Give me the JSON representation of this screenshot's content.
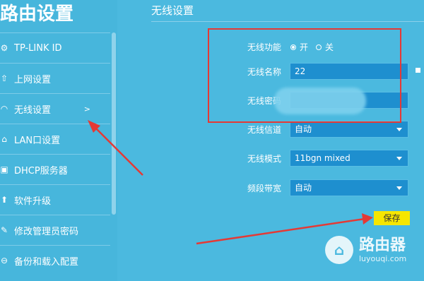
{
  "app": {
    "title": "路由设置"
  },
  "sidebar": {
    "items": [
      {
        "label": "TP-LINK ID",
        "icon": "gear-icon"
      },
      {
        "label": "上网设置",
        "icon": "internet-icon"
      },
      {
        "label": "无线设置",
        "icon": "wifi-icon",
        "selected": true,
        "arrow": ">"
      },
      {
        "label": "LAN口设置",
        "icon": "home-icon"
      },
      {
        "label": "DHCP服务器",
        "icon": "dhcp-icon"
      },
      {
        "label": "软件升级",
        "icon": "upgrade-icon"
      },
      {
        "label": "修改管理员密码",
        "icon": "pencil-icon"
      },
      {
        "label": "备份和载入配置",
        "icon": "backup-icon"
      }
    ]
  },
  "main": {
    "header": "无线设置",
    "wireless_function": {
      "label": "无线功能",
      "on": "开",
      "off": "关",
      "selected": "开"
    },
    "ssid": {
      "label": "无线名称",
      "value": "22"
    },
    "password": {
      "label": "无线密码",
      "value": ""
    },
    "channel": {
      "label": "无线信道",
      "value": "自动"
    },
    "mode": {
      "label": "无线模式",
      "value": "11bgn mixed"
    },
    "bandwidth": {
      "label": "频段带宽",
      "value": "自动"
    },
    "save_label": "保存"
  },
  "watermark": {
    "brand": "路由器",
    "url": "luyouqi.com"
  },
  "colors": {
    "background": "#4bb9df",
    "field": "#1e8fcf",
    "save": "#f6e600",
    "highlight": "#e53935"
  }
}
